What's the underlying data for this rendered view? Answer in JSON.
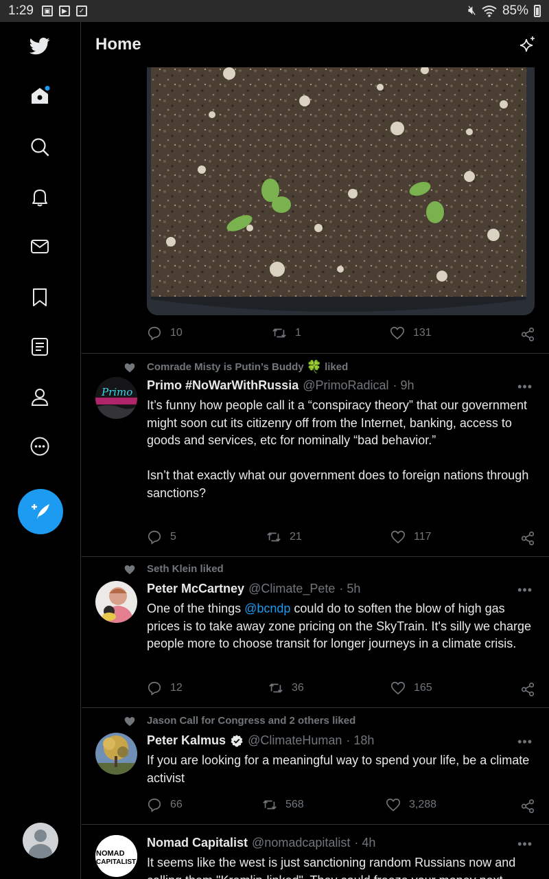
{
  "status_bar": {
    "time": "1:29",
    "battery": "85%"
  },
  "header": {
    "title": "Home"
  },
  "tweets": [
    {
      "replies": "10",
      "retweets": "1",
      "likes": "131"
    },
    {
      "social_context": "Comrade Misty is Putin’s Buddy",
      "social_emoji": "🍀",
      "social_suffix": "liked",
      "display_name": "Primo #NoWarWithRussia",
      "handle": "@PrimoRadical",
      "time": "· 9h",
      "avatar_text": "Primo",
      "text": "It’s funny how people call it a “conspiracy theory” that our government might soon cut its citizenry off from the Internet, banking, access to goods and services, etc for nominally “bad behavior.”\n\nIsn’t that exactly what our government does to foreign nations through sanctions?",
      "replies": "5",
      "retweets": "21",
      "likes": "117"
    },
    {
      "social_context": "Seth Klein liked",
      "display_name": "Peter McCartney",
      "handle": "@Climate_Pete",
      "time": "· 5h",
      "text_before": "One of the things ",
      "mention": "@bcndp",
      "text_after": " could do to soften the blow of high gas prices is to take away zone pricing on the SkyTrain. It's silly we charge people more to choose transit for longer journeys in a climate crisis.",
      "replies": "12",
      "retweets": "36",
      "likes": "165"
    },
    {
      "social_context": "Jason Call for Congress and 2 others liked",
      "display_name": "Peter Kalmus",
      "handle": "@ClimateHuman",
      "time": "· 18h",
      "text": "If you are looking for a meaningful way to spend your life, be a climate activist",
      "replies": "66",
      "retweets": "568",
      "likes": "3,288"
    },
    {
      "display_name": "Nomad Capitalist",
      "handle": "@nomadcapitalist",
      "time": "· 4h",
      "avatar_text_1": "NOMAD",
      "avatar_text_2": "CAPITALIST",
      "text": "It seems like the west is just sanctioning random Russians now and calling them \"Kremlin-linked\". They could freeze your money next"
    }
  ],
  "more_glyph": "•••",
  "colors": {
    "background": "#000000",
    "accent": "#1d9bf0",
    "text_primary": "#e7e9ea",
    "text_secondary": "#71767b",
    "divider": "#2f3336"
  },
  "icons": [
    "twitter-logo-icon",
    "home-icon",
    "search-icon",
    "bell-icon",
    "mail-icon",
    "bookmark-icon",
    "lists-icon",
    "profile-icon",
    "more-circle-icon",
    "compose-icon",
    "sparkle-icon",
    "reply-icon",
    "retweet-icon",
    "like-icon",
    "share-icon",
    "verified-icon"
  ]
}
